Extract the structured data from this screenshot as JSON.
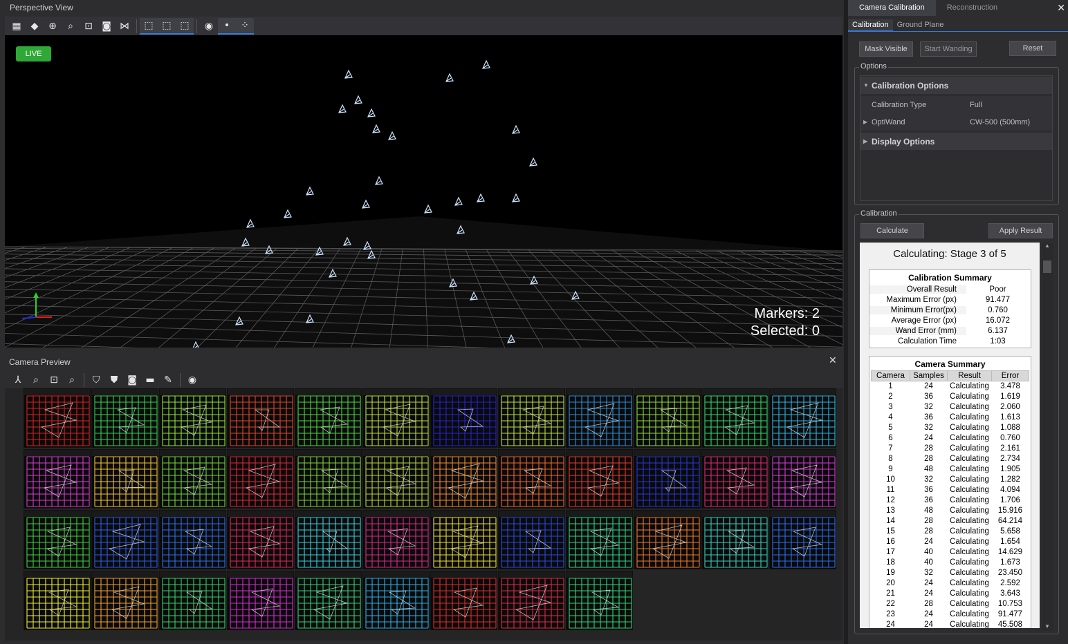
{
  "perspective": {
    "title": "Perspective View",
    "live_badge": "LIVE",
    "markers_text": "Markers: 2",
    "selected_text": "Selected: 0",
    "toolbar_icons": [
      "grid-view-icon",
      "cube-icon",
      "zoom-fit-icon",
      "zoom-selection-icon",
      "zoom-extents-icon",
      "camera-snapshot-icon",
      "network-icon",
      "select-rect-icon",
      "select-camera-icon",
      "select-marker-icon",
      "visibility-icon",
      "markers-toggle-icon",
      "assets-toggle-icon"
    ]
  },
  "camera_preview": {
    "title": "Camera Preview",
    "close_label": "✕",
    "toolbar_icons": [
      "layout-icon",
      "zoom-in-icon",
      "zoom-fit-icon",
      "zoom-icon",
      "mask-icon",
      "mask-fill-icon",
      "record-icon",
      "video-mode-icon",
      "brush-icon",
      "visibility-icon"
    ],
    "tile_colors": [
      [
        "#e02020",
        "#34d34f",
        "#8ee43a",
        "#e2462a",
        "#4dd83f",
        "#b7df3e",
        "#2424d6",
        "#b8e23a",
        "#2f8fd8",
        "#8ddd34",
        "#2ddd6a",
        "#2fb4e2"
      ],
      [
        "#d83bd4",
        "#f2c333",
        "#6fd43a",
        "#e0283a",
        "#7ed43a",
        "#b4d43a",
        "#f08a2a",
        "#f0662a",
        "#e53a2a",
        "#2838d6",
        "#e02870",
        "#d43ad4"
      ],
      [
        "#3fd43f",
        "#2a5de8",
        "#2a6ef0",
        "#e2285a",
        "#34d0e0",
        "#d82a8a",
        "#f0e02a",
        "#2a4ae0",
        "#2ad88a",
        "#f07a2a",
        "#34d0c0",
        "#2a6ef0"
      ],
      [
        "#f0f02a",
        "#f0a02a",
        "#34d06a",
        "#d82ad4",
        "#34d07a",
        "#2ab0e8",
        "#e02a2a",
        "#e02a4a",
        "#2ad87a"
      ]
    ]
  },
  "right_panel": {
    "tabs": [
      "Camera Calibration",
      "Reconstruction"
    ],
    "close_label": "✕",
    "subtabs": [
      "Calibration",
      "Ground Plane"
    ],
    "buttons": {
      "mask_visible": "Mask Visible",
      "start_wanding": "Start Wanding",
      "reset": "Reset",
      "calculate": "Calculate",
      "apply_result": "Apply Result"
    },
    "options_label": "Options",
    "calibration_group_label": "Calibration",
    "options": {
      "calibration_options": "Calibration Options",
      "calibration_type_key": "Calibration Type",
      "calibration_type_value": "Full",
      "optiwand_key": "OptiWand",
      "optiwand_value": "CW-500 (500mm)",
      "display_options": "Display Options"
    },
    "calc_stage": "Calculating: Stage 3 of 5",
    "summary_title": "Calibration Summary",
    "summary": [
      {
        "k": "Overall Result",
        "v": "Poor"
      },
      {
        "k": "Maximum Error (px)",
        "v": "91.477"
      },
      {
        "k": "Minimum Error(px)",
        "v": "0.760"
      },
      {
        "k": "Average Error (px)",
        "v": "16.072"
      },
      {
        "k": "Wand Error (mm)",
        "v": "6.137"
      },
      {
        "k": "Calculation Time",
        "v": "1:03"
      }
    ],
    "camera_summary_title": "Camera Summary",
    "camera_columns": [
      "Camera",
      "Samples",
      "Result",
      "Error"
    ],
    "cameras": [
      [
        "1",
        "24",
        "Calculating",
        "3.478"
      ],
      [
        "2",
        "36",
        "Calculating",
        "1.619"
      ],
      [
        "3",
        "32",
        "Calculating",
        "2.060"
      ],
      [
        "4",
        "36",
        "Calculating",
        "1.613"
      ],
      [
        "5",
        "32",
        "Calculating",
        "1.088"
      ],
      [
        "6",
        "24",
        "Calculating",
        "0.760"
      ],
      [
        "7",
        "28",
        "Calculating",
        "2.161"
      ],
      [
        "8",
        "28",
        "Calculating",
        "2.734"
      ],
      [
        "9",
        "48",
        "Calculating",
        "1.905"
      ],
      [
        "10",
        "32",
        "Calculating",
        "1.282"
      ],
      [
        "11",
        "36",
        "Calculating",
        "4.094"
      ],
      [
        "12",
        "36",
        "Calculating",
        "1.706"
      ],
      [
        "13",
        "48",
        "Calculating",
        "15.916"
      ],
      [
        "14",
        "28",
        "Calculating",
        "64.214"
      ],
      [
        "15",
        "28",
        "Calculating",
        "5.658"
      ],
      [
        "16",
        "24",
        "Calculating",
        "1.654"
      ],
      [
        "17",
        "40",
        "Calculating",
        "14.629"
      ],
      [
        "18",
        "40",
        "Calculating",
        "1.673"
      ],
      [
        "19",
        "32",
        "Calculating",
        "23.450"
      ],
      [
        "20",
        "24",
        "Calculating",
        "2.592"
      ],
      [
        "21",
        "24",
        "Calculating",
        "3.643"
      ],
      [
        "22",
        "28",
        "Calculating",
        "10.753"
      ],
      [
        "23",
        "24",
        "Calculating",
        "91.477"
      ],
      [
        "24",
        "24",
        "Calculating",
        "45.508"
      ]
    ]
  }
}
